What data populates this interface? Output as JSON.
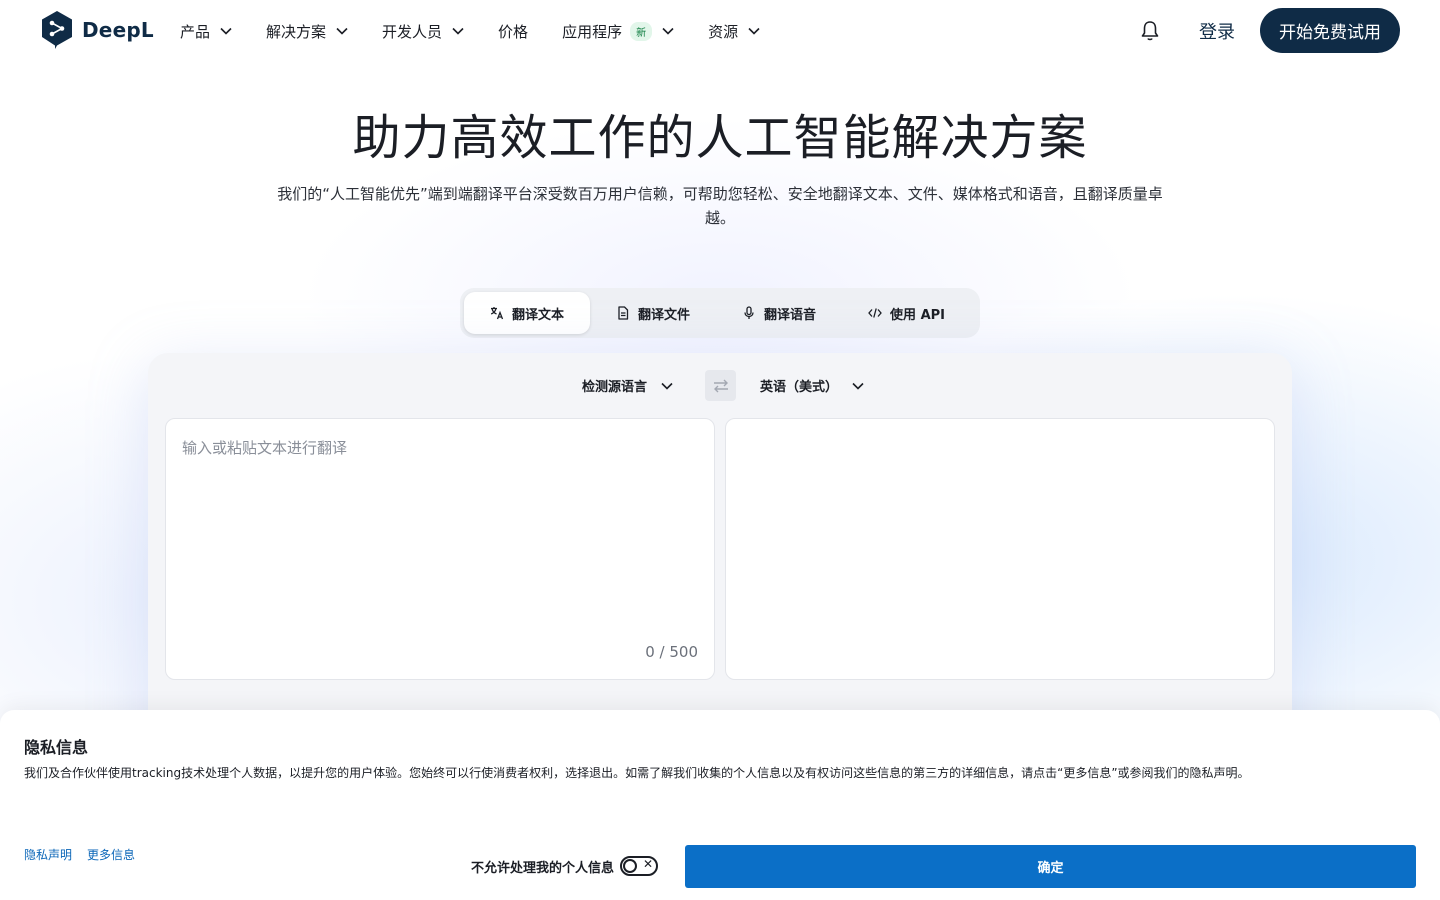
{
  "brand": {
    "name": "DeepL"
  },
  "nav": {
    "items": [
      {
        "label": "产品",
        "has_dropdown": true
      },
      {
        "label": "解决方案",
        "has_dropdown": true
      },
      {
        "label": "开发人员",
        "has_dropdown": true
      },
      {
        "label": "价格",
        "has_dropdown": false
      },
      {
        "label": "应用程序",
        "badge": "新",
        "has_dropdown": true
      },
      {
        "label": "资源",
        "has_dropdown": true
      }
    ],
    "login_label": "登录",
    "cta_label": "开始免费试用"
  },
  "hero": {
    "title": "助力高效工作的人工智能解决方案",
    "subtitle": "我们的“人工智能优先”端到端翻译平台深受数百万用户信赖，可帮助您轻松、安全地翻译文本、文件、媒体格式和语音，且翻译质量卓越。"
  },
  "tabs": [
    {
      "label": "翻译文本",
      "icon": "translate-icon",
      "active": true
    },
    {
      "label": "翻译文件",
      "icon": "document-icon",
      "active": false
    },
    {
      "label": "翻译语音",
      "icon": "microphone-icon",
      "active": false
    },
    {
      "label": "使用 API",
      "icon": "code-icon",
      "active": false
    }
  ],
  "translator": {
    "source_lang": "检测源语言",
    "target_lang": "英语（美式）",
    "source_placeholder": "输入或粘贴文本进行翻译",
    "source_value": "",
    "char_counter": "0 / 500",
    "target_value": ""
  },
  "privacy": {
    "title": "隐私信息",
    "text": "我们及合作伙伴使用tracking技术处理个人数据，以提升您的用户体验。您始终可以行使消费者权利，选择退出。如需了解我们收集的个人信息以及有权访问这些信息的第三方的详细信息，请点击“更多信息”或参阅我们的隐私声明。",
    "link_policy": "隐私声明",
    "link_more": "更多信息",
    "optout_label": "不允许处理我的个人信息",
    "confirm_label": "确定"
  },
  "colors": {
    "brand_dark": "#0f2b46",
    "confirm_blue": "#0b6fc7",
    "link_blue": "#0b66b8"
  }
}
